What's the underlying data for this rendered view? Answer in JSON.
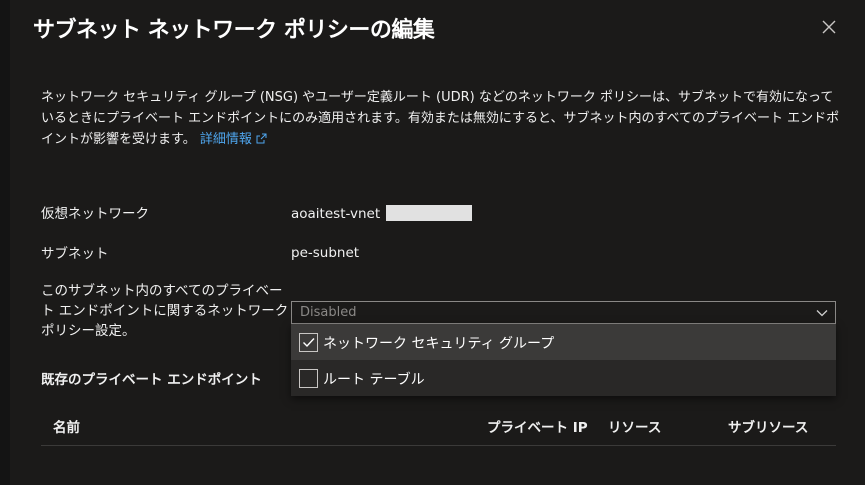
{
  "header": {
    "title": "サブネット ネットワーク ポリシーの編集"
  },
  "description": {
    "text": "ネットワーク セキュリティ グループ (NSG) やユーザー定義ルート (UDR) などのネットワーク ポリシーは、サブネットで有効になっているときにプライベート エンドポイントにのみ適用されます。有効または無効にすると、サブネット内のすべてのプライベート エンドポイントが影響を受けます。",
    "link_label": "詳細情報"
  },
  "fields": {
    "vnet_label": "仮想ネットワーク",
    "vnet_value": "aoaitest-vnet",
    "subnet_label": "サブネット",
    "subnet_value": "pe-subnet",
    "policy_label": "このサブネット内のすべてのプライベート エンドポイントに関するネットワーク ポリシー設定。"
  },
  "dropdown": {
    "selected": "Disabled",
    "options": [
      {
        "label": "ネットワーク セキュリティ グループ",
        "checked": true
      },
      {
        "label": "ルート テーブル",
        "checked": false
      }
    ]
  },
  "endpoints": {
    "section_title": "既存のプライベート エンドポイント",
    "columns": [
      "名前",
      "プライベート IP",
      "リソース",
      "サブリソース"
    ]
  },
  "colors": {
    "background": "#1b1a19",
    "link": "#4fa6ee",
    "dropdown_list": "#292827",
    "hover": "#3b3a39"
  },
  "icons": {
    "close": "close-icon",
    "external_link": "external-link-icon",
    "chevron": "chevron-down-icon",
    "check": "checkmark-icon"
  }
}
